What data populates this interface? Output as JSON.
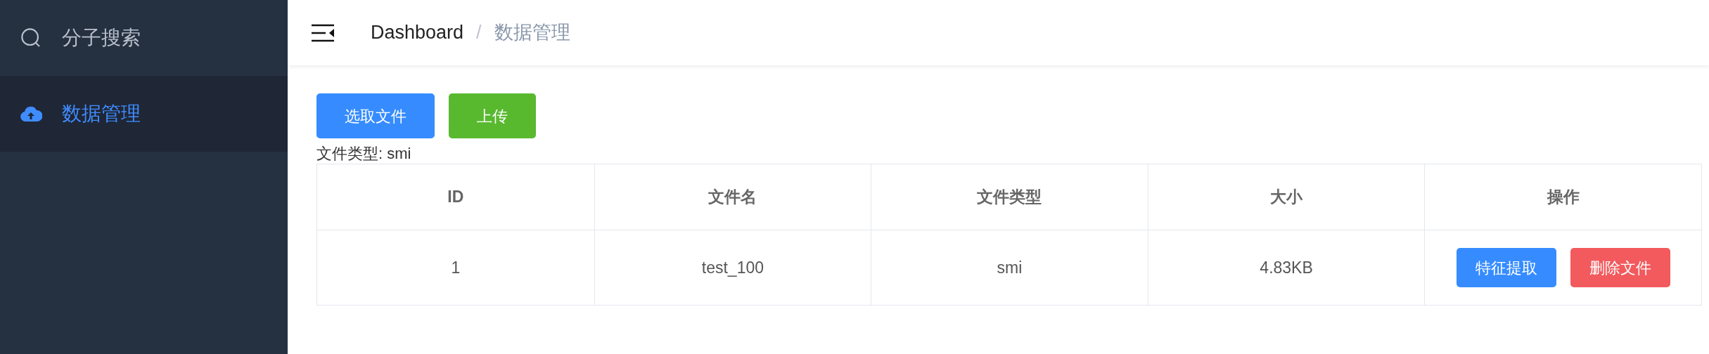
{
  "sidebar": {
    "items": [
      {
        "label": "分子搜索",
        "kind": "search",
        "selected": false
      },
      {
        "label": "数据管理",
        "kind": "upload",
        "selected": true
      }
    ]
  },
  "header": {
    "breadcrumb": [
      {
        "label": "Dashboard",
        "current": false
      },
      {
        "label": "数据管理",
        "current": true
      }
    ],
    "separator": "/"
  },
  "toolbar": {
    "buttons": [
      {
        "label": "选取文件",
        "kind": "primary"
      },
      {
        "label": "上传",
        "kind": "success"
      }
    ],
    "file_type": "文件类型: smi"
  },
  "table": {
    "columns": [
      "ID",
      "文件名",
      "文件类型",
      "大小",
      "操作"
    ],
    "rows": [
      {
        "cells": [
          "1",
          "test_100",
          "smi",
          "4.83KB"
        ],
        "actions": [
          {
            "label": "特征提取",
            "kind": "primary"
          },
          {
            "label": "删除文件",
            "kind": "danger"
          }
        ]
      }
    ]
  }
}
